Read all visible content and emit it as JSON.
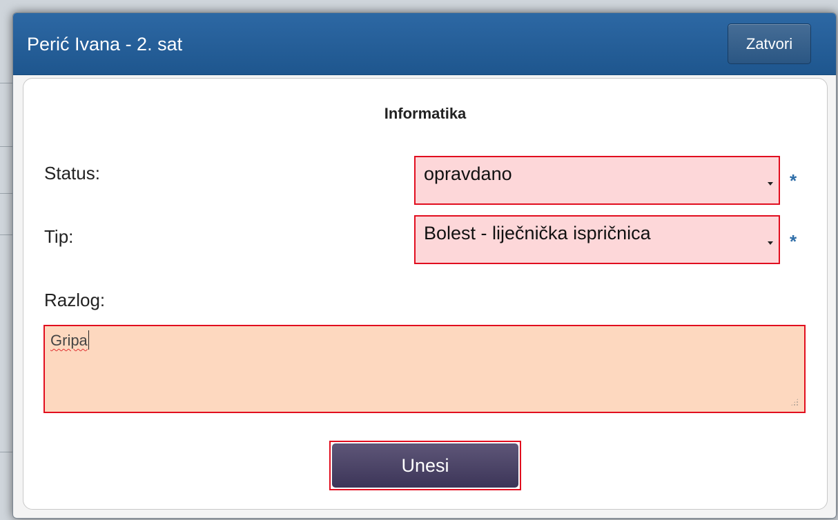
{
  "dialog": {
    "title": "Perić Ivana - 2. sat",
    "close_label": "Zatvori",
    "subject": "Informatika"
  },
  "form": {
    "status_label": "Status:",
    "status_value": "opravdano",
    "type_label": "Tip:",
    "type_value": "Bolest - liječnička ispričnica",
    "reason_label": "Razlog:",
    "reason_value": "Gripa",
    "required_mark": "*",
    "submit_label": "Unesi"
  },
  "colors": {
    "titlebar": "#1e568e",
    "error_border": "#e10d1e",
    "invalid_select_bg": "#fdd7d9",
    "textarea_bg": "#fdd8bf",
    "submit_bg": "#4a4366",
    "required_mark": "#2f6ea8"
  },
  "icons": {
    "select_arrow": "caret-down-icon",
    "resize": "resize-grip-icon"
  }
}
